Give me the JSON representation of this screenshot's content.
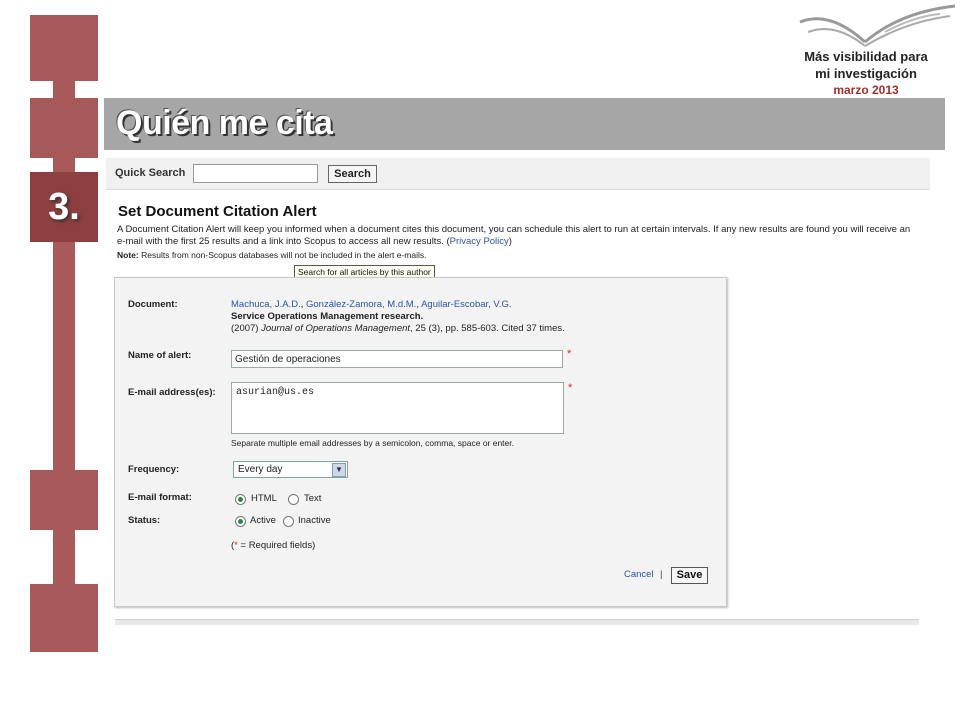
{
  "header": {
    "brand_line1": "Más visibilidad para",
    "brand_line2": "mi investigación",
    "date": "marzo 2013",
    "step": "3.",
    "title": "Quién me cita"
  },
  "quick_search": {
    "label": "Quick Search",
    "input_value": "",
    "button_label": "Search"
  },
  "page": {
    "title": "Set Document Citation Alert",
    "description": "A Document Citation Alert will keep you informed when a document cites this document, you can schedule this alert to run at certain intervals. If any new results are found you will receive an e-mail with the first 25 results and a link into Scopus to access all new results.",
    "privacy_link": "Privacy Policy",
    "note_label": "Note:",
    "note_text": "Results from non-Scopus databases will not be included in the alert e-mails.",
    "tooltip": "Search for all articles by this author"
  },
  "form": {
    "document_label": "Document:",
    "authors": [
      "Machuca, J.A.D.",
      "González-Zamora, M.d.M.",
      "Aguilar-Escobar, V.G."
    ],
    "doc_title": "Service Operations Management research.",
    "citation_year": "(2007)",
    "journal": "Journal of Operations Management",
    "citation_rest": ", 25 (3), pp. 585-603. Cited 37 times.",
    "alert_name_label": "Name of alert:",
    "alert_name_value": "Gestión de operaciones",
    "email_label": "E-mail address(es):",
    "email_value": "asurian@us.es",
    "email_hint": "Separate multiple email addresses by a semicolon, comma, space or enter.",
    "frequency_label": "Frequency:",
    "frequency_value": "Every day",
    "format_label": "E-mail format:",
    "format_html": "HTML",
    "format_text": "Text",
    "status_label": "Status:",
    "status_active": "Active",
    "status_inactive": "Inactive",
    "required_note_open": "(",
    "required_star": "*",
    "required_note_close": " = Required fields)",
    "cancel_label": "Cancel",
    "separator": "|",
    "save_label": "Save"
  },
  "colors": {
    "accent_bar": "#a85a5a",
    "step_box": "#8e3f3f",
    "banner": "#a6a6a6",
    "link": "#2a55a0",
    "required": "#d22222"
  }
}
